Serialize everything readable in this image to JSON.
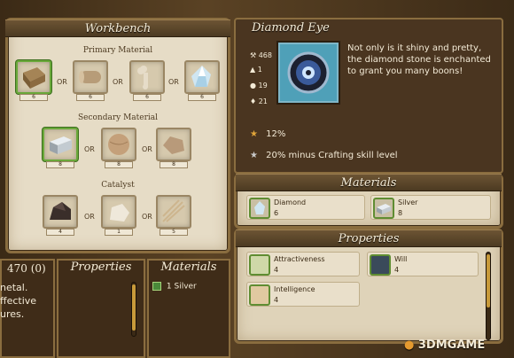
{
  "workbench": {
    "title": "Workbench",
    "primary_label": "Primary Material",
    "secondary_label": "Secondary Material",
    "catalyst_label": "Catalyst",
    "or_text": "OR",
    "primary_counts": [
      "6",
      "6",
      "6",
      "6"
    ],
    "secondary_counts": [
      "8",
      "8",
      "8"
    ],
    "catalyst_counts": [
      "4",
      "1",
      "5"
    ]
  },
  "item": {
    "name": "Diamond Eye",
    "description": "Not only is it shiny and pretty, the diamond stone is enchanted to grant you many boons!",
    "stats": [
      "468",
      "1",
      "19",
      "21"
    ],
    "bonus_percent": "12%",
    "crafting_note": "20% minus Crafting skill level"
  },
  "materials": {
    "title": "Materials",
    "items": [
      {
        "name": "Diamond",
        "count": "6"
      },
      {
        "name": "Silver",
        "count": "8"
      }
    ]
  },
  "properties": {
    "title": "Properties",
    "items": [
      {
        "name": "Attractiveness",
        "value": "4"
      },
      {
        "name": "Will",
        "value": "4"
      },
      {
        "name": "Intelligence",
        "value": "4"
      }
    ]
  },
  "bottom": {
    "left_header": "470 (0)",
    "left_text": [
      "netal.",
      "ffective",
      "ures."
    ],
    "properties_title": "Properties",
    "materials_title": "Materials",
    "materials_item_count": "1",
    "materials_item_name": "Silver"
  },
  "watermark": {
    "text": "3DMGAME"
  }
}
